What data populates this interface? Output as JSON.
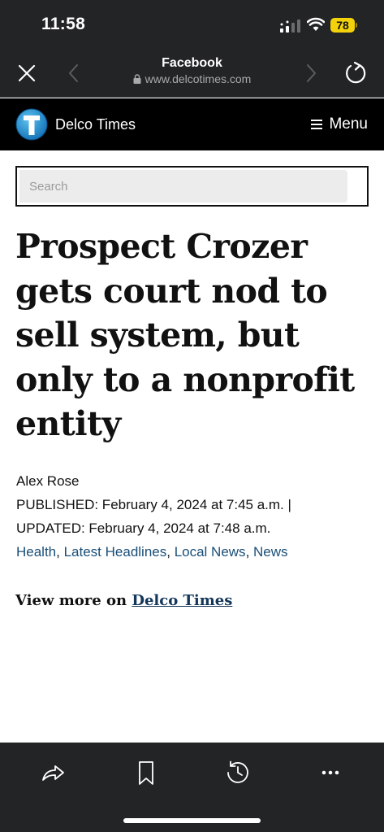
{
  "status_bar": {
    "time": "11:58",
    "battery": "78",
    "battery_color": "#f3d20b"
  },
  "browser": {
    "title": "Facebook",
    "url": "www.delcotimes.com",
    "icons": [
      "close-icon",
      "back-icon",
      "lock-icon",
      "forward-icon",
      "reload-icon"
    ]
  },
  "site_header": {
    "name": "Delco Times",
    "menu_label": "Menu",
    "logo_icon": "delco-times-logo",
    "background": "#000000"
  },
  "search": {
    "placeholder": "Search"
  },
  "article": {
    "headline": "Prospect Crozer gets court nod to sell system, but only to a nonprofit entity",
    "author": "Alex Rose",
    "published": "PUBLISHED: February 4, 2024 at 7:45 a.m. |",
    "updated": "UPDATED: February 4, 2024 at 7:48 a.m.",
    "categories": [
      "Health",
      "Latest Headlines",
      "Local News",
      "News"
    ],
    "category_color": "#1a4e77"
  },
  "view_more": {
    "prefix": "View more on",
    "link": "Delco Times"
  },
  "toolbar": {
    "icons": [
      "share-icon",
      "bookmark-icon",
      "history-icon",
      "more-icon"
    ]
  }
}
